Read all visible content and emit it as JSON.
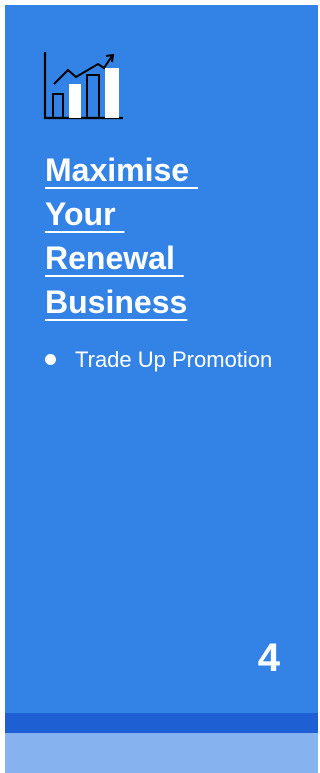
{
  "slide": {
    "icon": "growth-chart-icon",
    "title_lines": [
      "Maximise ",
      "Your ",
      "Renewal ",
      "Business"
    ],
    "bullets": [
      "Trade Up Promotion"
    ],
    "page_number": "4"
  },
  "colors": {
    "card_background": "#3382e6",
    "stripe_dark": "#1e5fd4",
    "stripe_light": "#86b2ef",
    "text": "#ffffff",
    "icon_stroke": "#000000"
  }
}
